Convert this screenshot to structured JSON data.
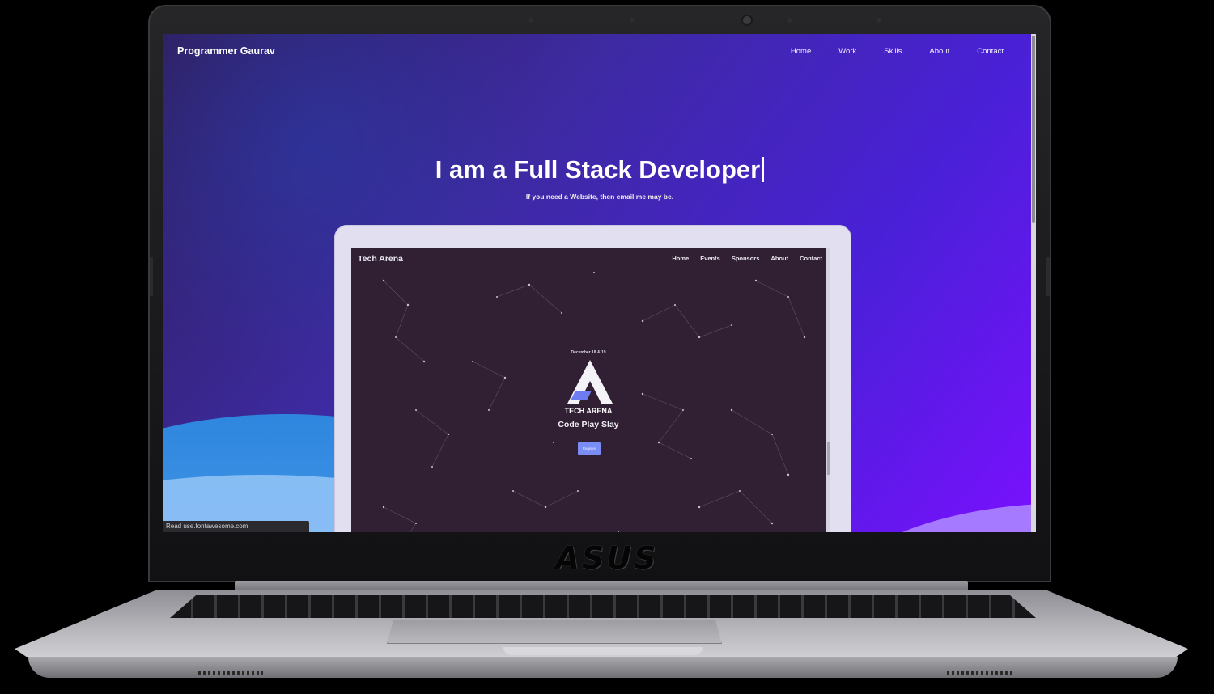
{
  "hardware": {
    "brand": "ASUS"
  },
  "site": {
    "logo": "Programmer Gaurav",
    "nav": [
      "Home",
      "Work",
      "Skills",
      "About",
      "Contact"
    ],
    "headline": "I am a Full Stack Developer",
    "subline": "If you need a Website, then email me may be.",
    "status_bar": "Read use.fontawesome.com"
  },
  "mockup": {
    "logo": "Tech Arena",
    "nav": [
      "Home",
      "Events",
      "Sponsors",
      "About",
      "Contact"
    ],
    "date": "December 18 & 19",
    "name": "TECH ARENA",
    "tagline": "Code Play Slay",
    "button": "Register"
  },
  "colors": {
    "accent": "#4a20d8",
    "button": "#7a8df5",
    "mock_bg": "#312033"
  }
}
